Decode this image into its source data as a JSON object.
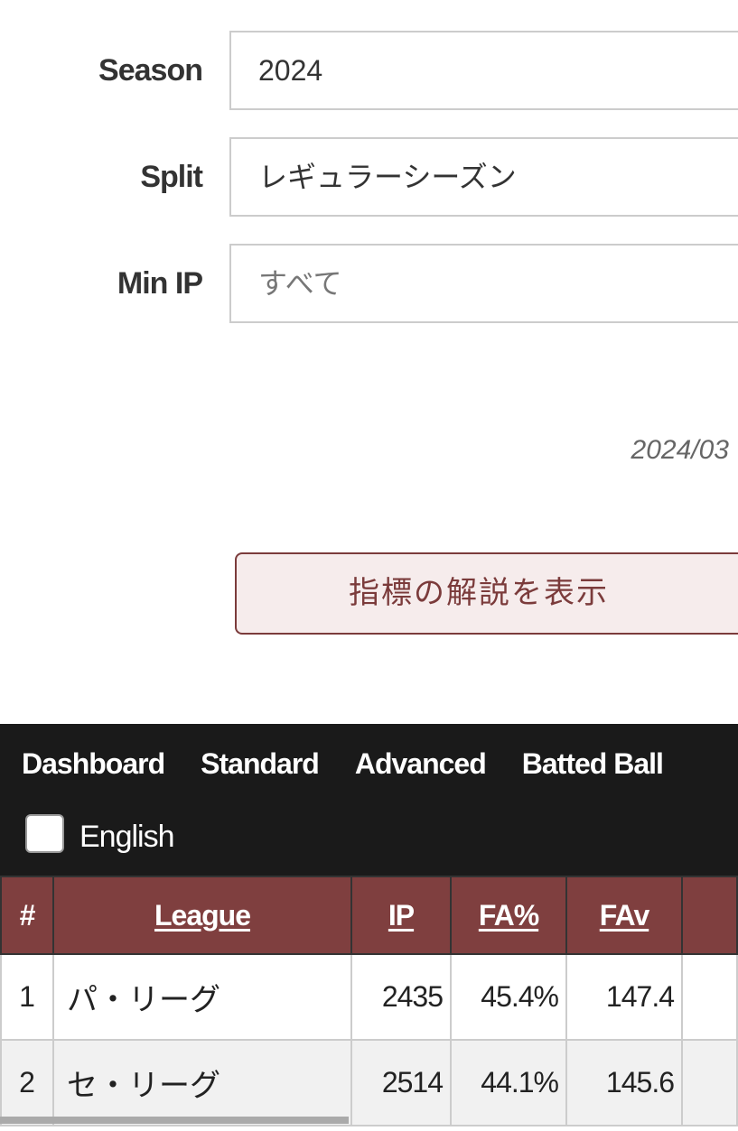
{
  "filters": [
    {
      "label": "Season",
      "value": "2024",
      "placeholder": false
    },
    {
      "label": "Split",
      "value": "レギュラーシーズン",
      "placeholder": false
    },
    {
      "label": "Min IP",
      "value": "すべて",
      "placeholder": true
    }
  ],
  "updated_date": "2024/03",
  "show_glossary_button": "指標の解説を表示",
  "nav": {
    "tabs": [
      "Dashboard",
      "Standard",
      "Advanced",
      "Batted Ball"
    ],
    "english_label": "English",
    "english_checked": false
  },
  "table": {
    "headers": [
      "#",
      "League",
      "IP",
      "FA%",
      "FAv"
    ],
    "rows": [
      [
        "1",
        "パ・リーグ",
        "2435",
        "45.4%",
        "147.4"
      ],
      [
        "2",
        "セ・リーグ",
        "2514",
        "44.1%",
        "145.6"
      ]
    ]
  },
  "colors": {
    "header": "#7f3f3f",
    "nav": "#1a1a1a",
    "button_text": "#7b3b3b"
  }
}
